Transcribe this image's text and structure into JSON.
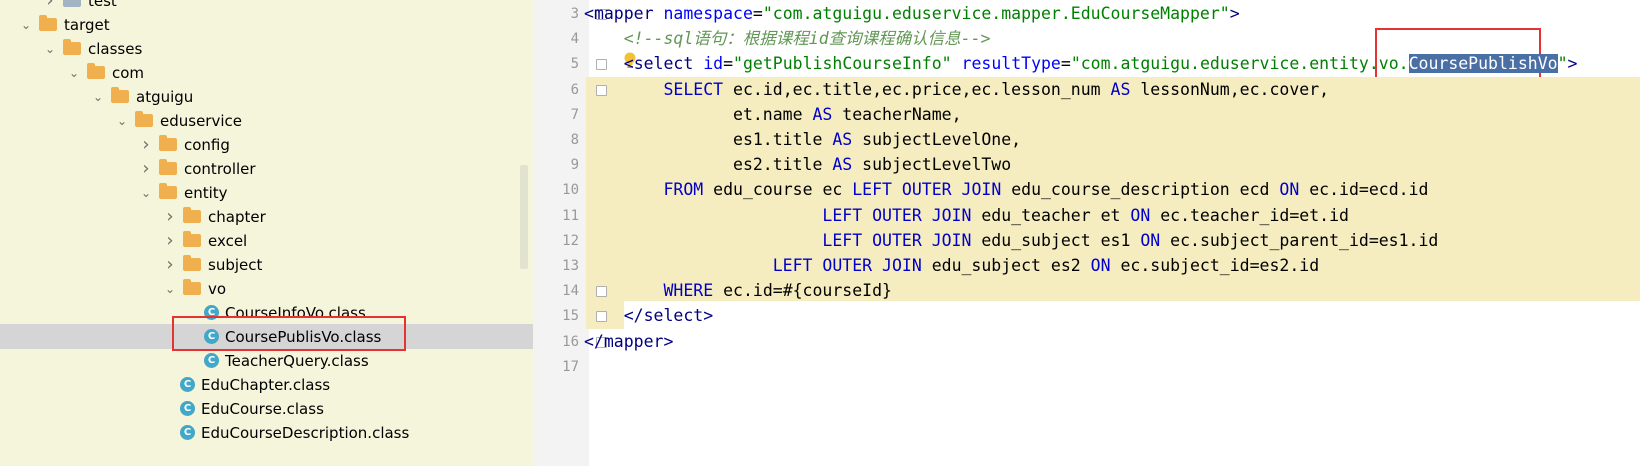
{
  "project_tree": {
    "items": [
      {
        "label": "test",
        "depth": 2,
        "kind": "folder-gray",
        "arrow": "right"
      },
      {
        "label": "target",
        "depth": 1,
        "kind": "folder",
        "arrow": "down"
      },
      {
        "label": "classes",
        "depth": 2,
        "kind": "folder",
        "arrow": "down"
      },
      {
        "label": "com",
        "depth": 3,
        "kind": "folder",
        "arrow": "down"
      },
      {
        "label": "atguigu",
        "depth": 4,
        "kind": "folder",
        "arrow": "down"
      },
      {
        "label": "eduservice",
        "depth": 5,
        "kind": "folder",
        "arrow": "down"
      },
      {
        "label": "config",
        "depth": 6,
        "kind": "folder",
        "arrow": "right"
      },
      {
        "label": "controller",
        "depth": 6,
        "kind": "folder",
        "arrow": "right"
      },
      {
        "label": "entity",
        "depth": 6,
        "kind": "folder",
        "arrow": "down"
      },
      {
        "label": "chapter",
        "depth": 7,
        "kind": "folder",
        "arrow": "right"
      },
      {
        "label": "excel",
        "depth": 7,
        "kind": "folder",
        "arrow": "right"
      },
      {
        "label": "subject",
        "depth": 7,
        "kind": "folder",
        "arrow": "right"
      },
      {
        "label": "vo",
        "depth": 7,
        "kind": "folder",
        "arrow": "down"
      },
      {
        "label": "CourseInfoVo.class",
        "depth": 8,
        "kind": "class",
        "arrow": ""
      },
      {
        "label": "CoursePublisVo.class",
        "depth": 8,
        "kind": "class",
        "arrow": "",
        "selected": true
      },
      {
        "label": "TeacherQuery.class",
        "depth": 8,
        "kind": "class",
        "arrow": ""
      },
      {
        "label": "EduChapter.class",
        "depth": 7,
        "kind": "class",
        "arrow": ""
      },
      {
        "label": "EduCourse.class",
        "depth": 7,
        "kind": "class",
        "arrow": ""
      },
      {
        "label": "EduCourseDescription.class",
        "depth": 7,
        "kind": "class",
        "arrow": ""
      }
    ],
    "class_icon_letter": "C"
  },
  "editor": {
    "line_numbers": [
      "3",
      "4",
      "5",
      "6",
      "7",
      "8",
      "9",
      "10",
      "11",
      "12",
      "13",
      "14",
      "15",
      "16",
      "17"
    ],
    "lines": [
      [
        {
          "t": "<",
          "c": "tag"
        },
        {
          "t": "mapper",
          "c": "tag"
        },
        {
          "t": " "
        },
        {
          "t": "namespace",
          "c": "attr"
        },
        {
          "t": "=",
          "c": ""
        },
        {
          "t": "\"com.atguigu.eduservice.mapper.EduCourseMapper\"",
          "c": "str"
        },
        {
          "t": ">",
          "c": "tag"
        }
      ],
      [
        {
          "t": "    "
        },
        {
          "t": "<!--sql语句：根据课程id查询课程确认信息-->",
          "c": "cm"
        }
      ],
      [
        {
          "t": "    "
        },
        {
          "t": "<",
          "c": "tag"
        },
        {
          "t": "select",
          "c": "tag"
        },
        {
          "t": " "
        },
        {
          "t": "id",
          "c": "attr"
        },
        {
          "t": "="
        },
        {
          "t": "\"getPublishCourseInfo\"",
          "c": "str"
        },
        {
          "t": " "
        },
        {
          "t": "resultType",
          "c": "attr"
        },
        {
          "t": "="
        },
        {
          "t": "\"com.atguigu.eduservice.entity.vo.",
          "c": "str"
        },
        {
          "t": "CoursePublishVo",
          "c": "str sel-text"
        },
        {
          "t": "\"",
          "c": "str"
        },
        {
          "t": ">",
          "c": "tag"
        }
      ],
      [
        {
          "t": "        "
        },
        {
          "t": "SELECT",
          "c": "kw"
        },
        {
          "t": " ec.id,ec.title,ec.price,ec.lesson_num "
        },
        {
          "t": "AS",
          "c": "kw"
        },
        {
          "t": " lessonNum,ec.cover,"
        }
      ],
      [
        {
          "t": "               et.name "
        },
        {
          "t": "AS",
          "c": "kw"
        },
        {
          "t": " teacherName,"
        }
      ],
      [
        {
          "t": "               es1.title "
        },
        {
          "t": "AS",
          "c": "kw"
        },
        {
          "t": " subjectLevelOne,"
        }
      ],
      [
        {
          "t": "               es2.title "
        },
        {
          "t": "AS",
          "c": "kw"
        },
        {
          "t": " subjectLevelTwo"
        }
      ],
      [
        {
          "t": "        "
        },
        {
          "t": "FROM",
          "c": "kw"
        },
        {
          "t": " edu_course ec "
        },
        {
          "t": "LEFT OUTER JOIN",
          "c": "kw"
        },
        {
          "t": " edu_course_description ecd "
        },
        {
          "t": "ON",
          "c": "kw"
        },
        {
          "t": " ec.id=ecd.id"
        }
      ],
      [
        {
          "t": "                        "
        },
        {
          "t": "LEFT OUTER JOIN",
          "c": "kw"
        },
        {
          "t": " edu_teacher et "
        },
        {
          "t": "ON",
          "c": "kw"
        },
        {
          "t": " ec.teacher_id=et.id"
        }
      ],
      [
        {
          "t": "                        "
        },
        {
          "t": "LEFT OUTER JOIN",
          "c": "kw"
        },
        {
          "t": " edu_subject es1 "
        },
        {
          "t": "ON",
          "c": "kw"
        },
        {
          "t": " ec.subject_parent_id=es1.id"
        }
      ],
      [
        {
          "t": "                   "
        },
        {
          "t": "LEFT OUTER JOIN",
          "c": "kw"
        },
        {
          "t": " edu_subject es2 "
        },
        {
          "t": "ON",
          "c": "kw"
        },
        {
          "t": " ec.subject_id=es2.id"
        }
      ],
      [
        {
          "t": "        "
        },
        {
          "t": "WHERE",
          "c": "kw"
        },
        {
          "t": " ec.id=#{courseId}"
        }
      ],
      [
        {
          "t": "    "
        },
        {
          "t": "</",
          "c": "tag"
        },
        {
          "t": "select",
          "c": "tag"
        },
        {
          "t": ">",
          "c": "tag"
        }
      ],
      [
        {
          "t": "</",
          "c": "tag"
        },
        {
          "t": "mapper",
          "c": "tag"
        },
        {
          "t": ">",
          "c": "tag"
        }
      ],
      []
    ]
  },
  "colors": {
    "tree_bg": "#f5f5dc",
    "selection_row": "#d5d5d5",
    "highlight_band": "#f5ecc0",
    "annotation_red": "#e53333",
    "tag": "#000080",
    "attribute": "#0000ff",
    "string": "#008000",
    "keyword": "#0000c8",
    "comment": "#629755"
  }
}
